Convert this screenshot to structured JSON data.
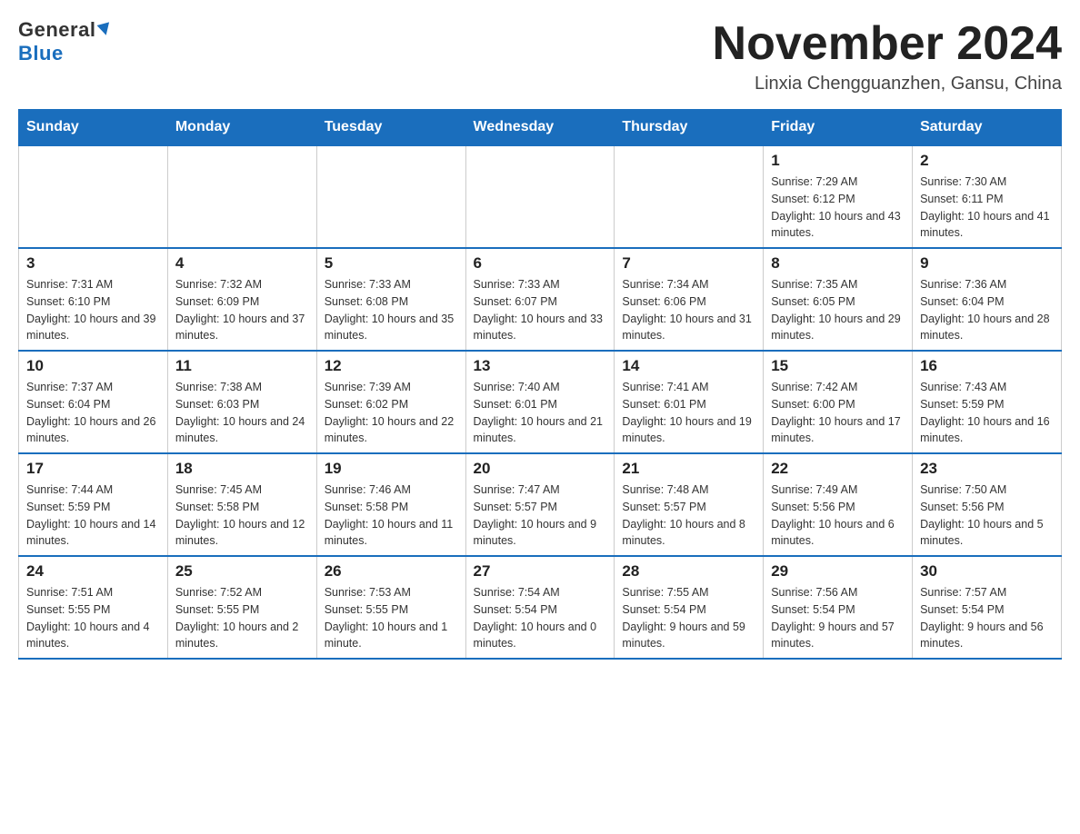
{
  "header": {
    "logo_general": "General",
    "logo_blue": "Blue",
    "month_title": "November 2024",
    "location": "Linxia Chengguanzhen, Gansu, China"
  },
  "weekdays": [
    "Sunday",
    "Monday",
    "Tuesday",
    "Wednesday",
    "Thursday",
    "Friday",
    "Saturday"
  ],
  "weeks": [
    [
      {
        "day": "",
        "info": ""
      },
      {
        "day": "",
        "info": ""
      },
      {
        "day": "",
        "info": ""
      },
      {
        "day": "",
        "info": ""
      },
      {
        "day": "",
        "info": ""
      },
      {
        "day": "1",
        "info": "Sunrise: 7:29 AM\nSunset: 6:12 PM\nDaylight: 10 hours and 43 minutes."
      },
      {
        "day": "2",
        "info": "Sunrise: 7:30 AM\nSunset: 6:11 PM\nDaylight: 10 hours and 41 minutes."
      }
    ],
    [
      {
        "day": "3",
        "info": "Sunrise: 7:31 AM\nSunset: 6:10 PM\nDaylight: 10 hours and 39 minutes."
      },
      {
        "day": "4",
        "info": "Sunrise: 7:32 AM\nSunset: 6:09 PM\nDaylight: 10 hours and 37 minutes."
      },
      {
        "day": "5",
        "info": "Sunrise: 7:33 AM\nSunset: 6:08 PM\nDaylight: 10 hours and 35 minutes."
      },
      {
        "day": "6",
        "info": "Sunrise: 7:33 AM\nSunset: 6:07 PM\nDaylight: 10 hours and 33 minutes."
      },
      {
        "day": "7",
        "info": "Sunrise: 7:34 AM\nSunset: 6:06 PM\nDaylight: 10 hours and 31 minutes."
      },
      {
        "day": "8",
        "info": "Sunrise: 7:35 AM\nSunset: 6:05 PM\nDaylight: 10 hours and 29 minutes."
      },
      {
        "day": "9",
        "info": "Sunrise: 7:36 AM\nSunset: 6:04 PM\nDaylight: 10 hours and 28 minutes."
      }
    ],
    [
      {
        "day": "10",
        "info": "Sunrise: 7:37 AM\nSunset: 6:04 PM\nDaylight: 10 hours and 26 minutes."
      },
      {
        "day": "11",
        "info": "Sunrise: 7:38 AM\nSunset: 6:03 PM\nDaylight: 10 hours and 24 minutes."
      },
      {
        "day": "12",
        "info": "Sunrise: 7:39 AM\nSunset: 6:02 PM\nDaylight: 10 hours and 22 minutes."
      },
      {
        "day": "13",
        "info": "Sunrise: 7:40 AM\nSunset: 6:01 PM\nDaylight: 10 hours and 21 minutes."
      },
      {
        "day": "14",
        "info": "Sunrise: 7:41 AM\nSunset: 6:01 PM\nDaylight: 10 hours and 19 minutes."
      },
      {
        "day": "15",
        "info": "Sunrise: 7:42 AM\nSunset: 6:00 PM\nDaylight: 10 hours and 17 minutes."
      },
      {
        "day": "16",
        "info": "Sunrise: 7:43 AM\nSunset: 5:59 PM\nDaylight: 10 hours and 16 minutes."
      }
    ],
    [
      {
        "day": "17",
        "info": "Sunrise: 7:44 AM\nSunset: 5:59 PM\nDaylight: 10 hours and 14 minutes."
      },
      {
        "day": "18",
        "info": "Sunrise: 7:45 AM\nSunset: 5:58 PM\nDaylight: 10 hours and 12 minutes."
      },
      {
        "day": "19",
        "info": "Sunrise: 7:46 AM\nSunset: 5:58 PM\nDaylight: 10 hours and 11 minutes."
      },
      {
        "day": "20",
        "info": "Sunrise: 7:47 AM\nSunset: 5:57 PM\nDaylight: 10 hours and 9 minutes."
      },
      {
        "day": "21",
        "info": "Sunrise: 7:48 AM\nSunset: 5:57 PM\nDaylight: 10 hours and 8 minutes."
      },
      {
        "day": "22",
        "info": "Sunrise: 7:49 AM\nSunset: 5:56 PM\nDaylight: 10 hours and 6 minutes."
      },
      {
        "day": "23",
        "info": "Sunrise: 7:50 AM\nSunset: 5:56 PM\nDaylight: 10 hours and 5 minutes."
      }
    ],
    [
      {
        "day": "24",
        "info": "Sunrise: 7:51 AM\nSunset: 5:55 PM\nDaylight: 10 hours and 4 minutes."
      },
      {
        "day": "25",
        "info": "Sunrise: 7:52 AM\nSunset: 5:55 PM\nDaylight: 10 hours and 2 minutes."
      },
      {
        "day": "26",
        "info": "Sunrise: 7:53 AM\nSunset: 5:55 PM\nDaylight: 10 hours and 1 minute."
      },
      {
        "day": "27",
        "info": "Sunrise: 7:54 AM\nSunset: 5:54 PM\nDaylight: 10 hours and 0 minutes."
      },
      {
        "day": "28",
        "info": "Sunrise: 7:55 AM\nSunset: 5:54 PM\nDaylight: 9 hours and 59 minutes."
      },
      {
        "day": "29",
        "info": "Sunrise: 7:56 AM\nSunset: 5:54 PM\nDaylight: 9 hours and 57 minutes."
      },
      {
        "day": "30",
        "info": "Sunrise: 7:57 AM\nSunset: 5:54 PM\nDaylight: 9 hours and 56 minutes."
      }
    ]
  ]
}
